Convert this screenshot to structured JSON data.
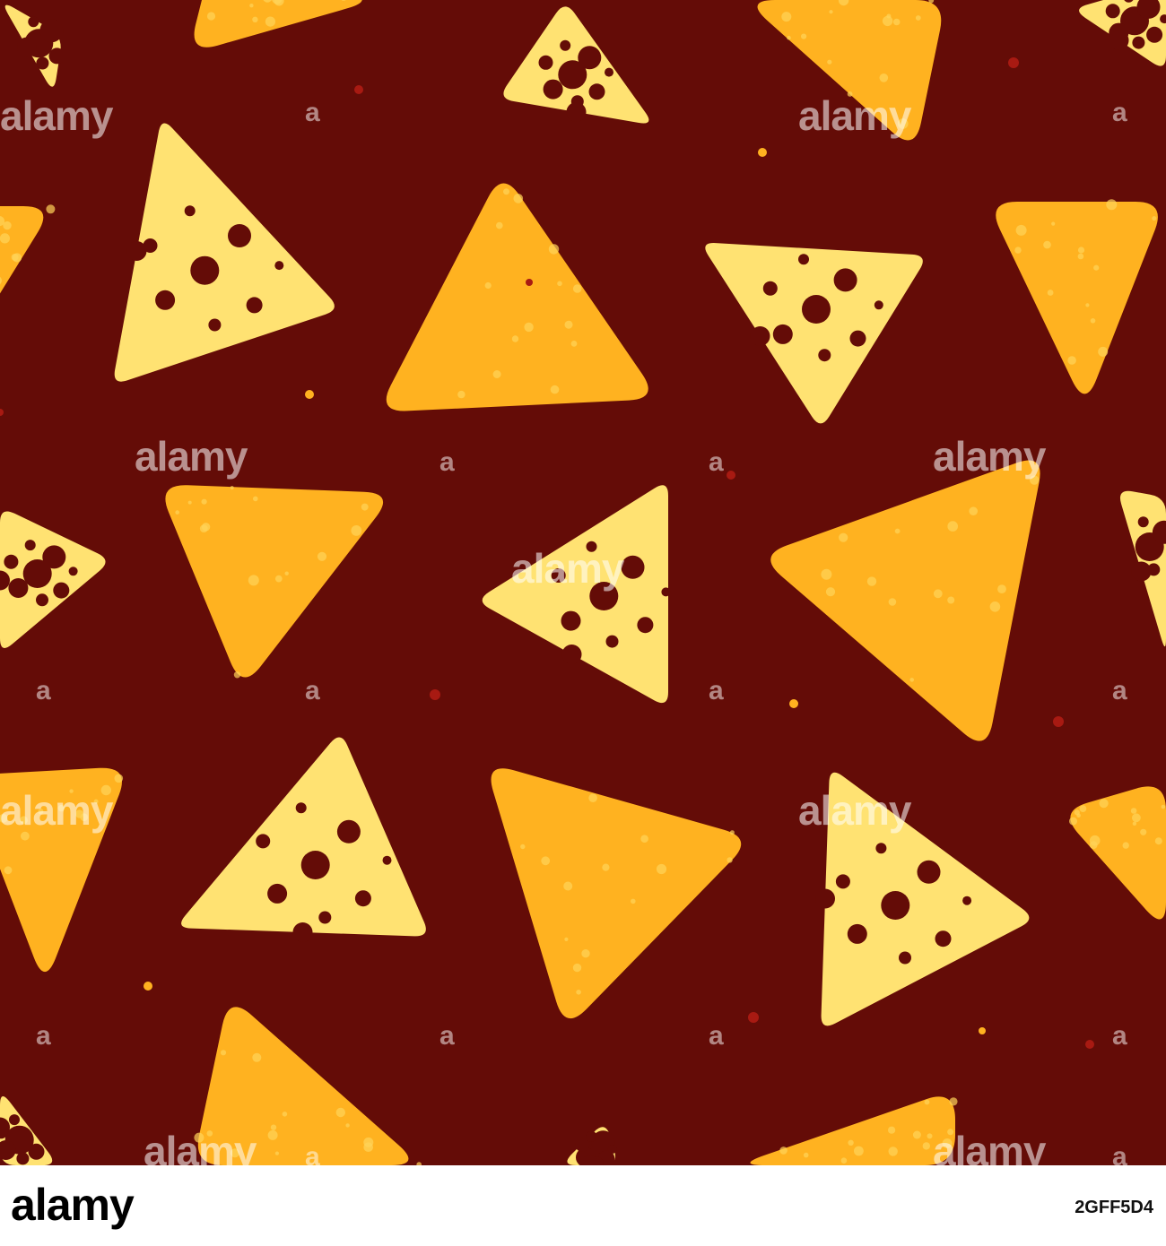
{
  "colors": {
    "background": "#640c07",
    "nacho": "#ffb220",
    "nacho_speck": "#ffd45a",
    "cheese": "#ffe272",
    "hole": "#640c07",
    "crumb_red": "#a81a12",
    "crumb_yellow": "#ffb220"
  },
  "watermark": {
    "text": "alamy",
    "mark": "a"
  },
  "footer": {
    "logo": "alamy",
    "image_id": "2GFF5D4"
  }
}
